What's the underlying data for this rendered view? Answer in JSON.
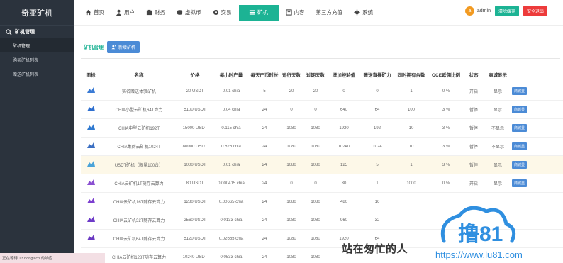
{
  "sidebar": {
    "brand": "奇亚矿机",
    "section": "矿机管理",
    "items": [
      {
        "label": "矿机管理",
        "active": true
      },
      {
        "label": "购买矿机列表",
        "active": false
      },
      {
        "label": "赠送矿机列表",
        "active": false
      }
    ]
  },
  "topnav": [
    {
      "label": "首页",
      "icon": "home-icon"
    },
    {
      "label": "用户",
      "icon": "user-icon"
    },
    {
      "label": "财务",
      "icon": "finance-icon"
    },
    {
      "label": "虚拟币",
      "icon": "coin-icon"
    },
    {
      "label": "交易",
      "icon": "trade-icon"
    },
    {
      "label": "矿机",
      "icon": "list-icon",
      "active": true
    },
    {
      "label": "内容",
      "icon": "content-icon"
    },
    {
      "label": "第三方充值",
      "icon": ""
    },
    {
      "label": "系统",
      "icon": "gear-icon"
    }
  ],
  "user": {
    "avatar": "a",
    "name": "admin",
    "clear_cache": "清除缓存",
    "logout": "安全退出"
  },
  "toolbar": {
    "title": "矿机管理",
    "add_button": "新增矿机"
  },
  "table": {
    "headers": [
      "图标",
      "名称",
      "价格",
      "每小时产量",
      "每天产币时长",
      "运行天数",
      "过期天数",
      "增加经验值",
      "赠送直推矿力",
      "同时拥有台数",
      "OCE返佣比例",
      "状态",
      "商城显示",
      ""
    ],
    "rows": [
      {
        "icon_color": "#3a7bd5",
        "name": "实名赠送体验矿机",
        "price": "20 USDT",
        "hour": "0.01 chia",
        "dur": "5",
        "run": "20",
        "exp": "20",
        "inc": "0",
        "gift": "0",
        "same": "1",
        "oce": "0 %",
        "state": "开启",
        "shop": "显示",
        "op": "商城显"
      },
      {
        "icon_color": "#2e6fcf",
        "name": "CHIA小型云矿机64T算力",
        "price": "5100 USDT",
        "hour": "0.04 chia",
        "dur": "24",
        "run": "0",
        "exp": "0",
        "inc": "640",
        "gift": "64",
        "same": "100",
        "oce": "3 %",
        "state": "暂停",
        "shop": "显示",
        "op": "商城显"
      },
      {
        "icon_color": "#2f79d0",
        "name": "CHIA中型云矿机192T",
        "price": "15000 USDT",
        "hour": "0.115 chia",
        "dur": "24",
        "run": "1080",
        "exp": "1080",
        "inc": "1920",
        "gift": "192",
        "same": "10",
        "oce": "3 %",
        "state": "暂停",
        "shop": "不显示",
        "op": "商城显"
      },
      {
        "icon_color": "#3b6fc2",
        "name": "CHIA集群云矿机1024T",
        "price": "80000 USDT",
        "hour": "0.625 chia",
        "dur": "24",
        "run": "1080",
        "exp": "1080",
        "inc": "10240",
        "gift": "1024",
        "same": "10",
        "oce": "3 %",
        "state": "暂停",
        "shop": "不显示",
        "op": "商城显"
      },
      {
        "icon_color": "#4aa3d8",
        "name": "USDT矿机（限量100台）",
        "price": "1000 USDT",
        "hour": "0.01 chia",
        "dur": "24",
        "run": "1080",
        "exp": "1080",
        "inc": "125",
        "gift": "5",
        "same": "1",
        "oce": "3 %",
        "state": "暂停",
        "shop": "显示",
        "op": "商城显",
        "highlight": true
      },
      {
        "icon_color": "#8a4fd1",
        "name": "CHIA云矿机1T随存云算力",
        "price": "80 USDT",
        "hour": "0.000415 chia",
        "dur": "24",
        "run": "0",
        "exp": "0",
        "inc": "30",
        "gift": "1",
        "same": "1000",
        "oce": "0 %",
        "state": "开启",
        "shop": "显示",
        "op": "商城显"
      },
      {
        "icon_color": "#7c3fcf",
        "name": "CHIA云矿机16T随存云算力",
        "price": "1280 USDT",
        "hour": "0.00665 chia",
        "dur": "24",
        "run": "1080",
        "exp": "1080",
        "inc": "480",
        "gift": "16",
        "same": "",
        "oce": "",
        "state": "",
        "shop": "",
        "op": ""
      },
      {
        "icon_color": "#6d3bc8",
        "name": "CHIA云矿机32T随存云算力",
        "price": "2560 USDT",
        "hour": "0.0133 chia",
        "dur": "24",
        "run": "1080",
        "exp": "1080",
        "inc": "960",
        "gift": "32",
        "same": "",
        "oce": "",
        "state": "",
        "shop": "",
        "op": ""
      },
      {
        "icon_color": "#6a39c2",
        "name": "CHIA云矿机64T随存云算力",
        "price": "5120 USDT",
        "hour": "0.02665 chia",
        "dur": "24",
        "run": "1080",
        "exp": "1080",
        "inc": "1920",
        "gift": "64",
        "same": "",
        "oce": "",
        "state": "",
        "shop": "",
        "op": ""
      },
      {
        "icon_color": "#5d33b8",
        "name": "CHIA云矿机128T随存云算力",
        "price": "10240 USDT",
        "hour": "0.0533 chia",
        "dur": "24",
        "run": "1080",
        "exp": "1080",
        "inc": "",
        "gift": "",
        "same": "",
        "oce": "",
        "state": "",
        "shop": "",
        "op": ""
      }
    ]
  },
  "status_bar": "正在等待 13.hongll.cn 的响应...",
  "watermark": {
    "slogan": "站在匆忙的人",
    "logo_text": "撸81",
    "url": "https://www.lu81.com"
  }
}
